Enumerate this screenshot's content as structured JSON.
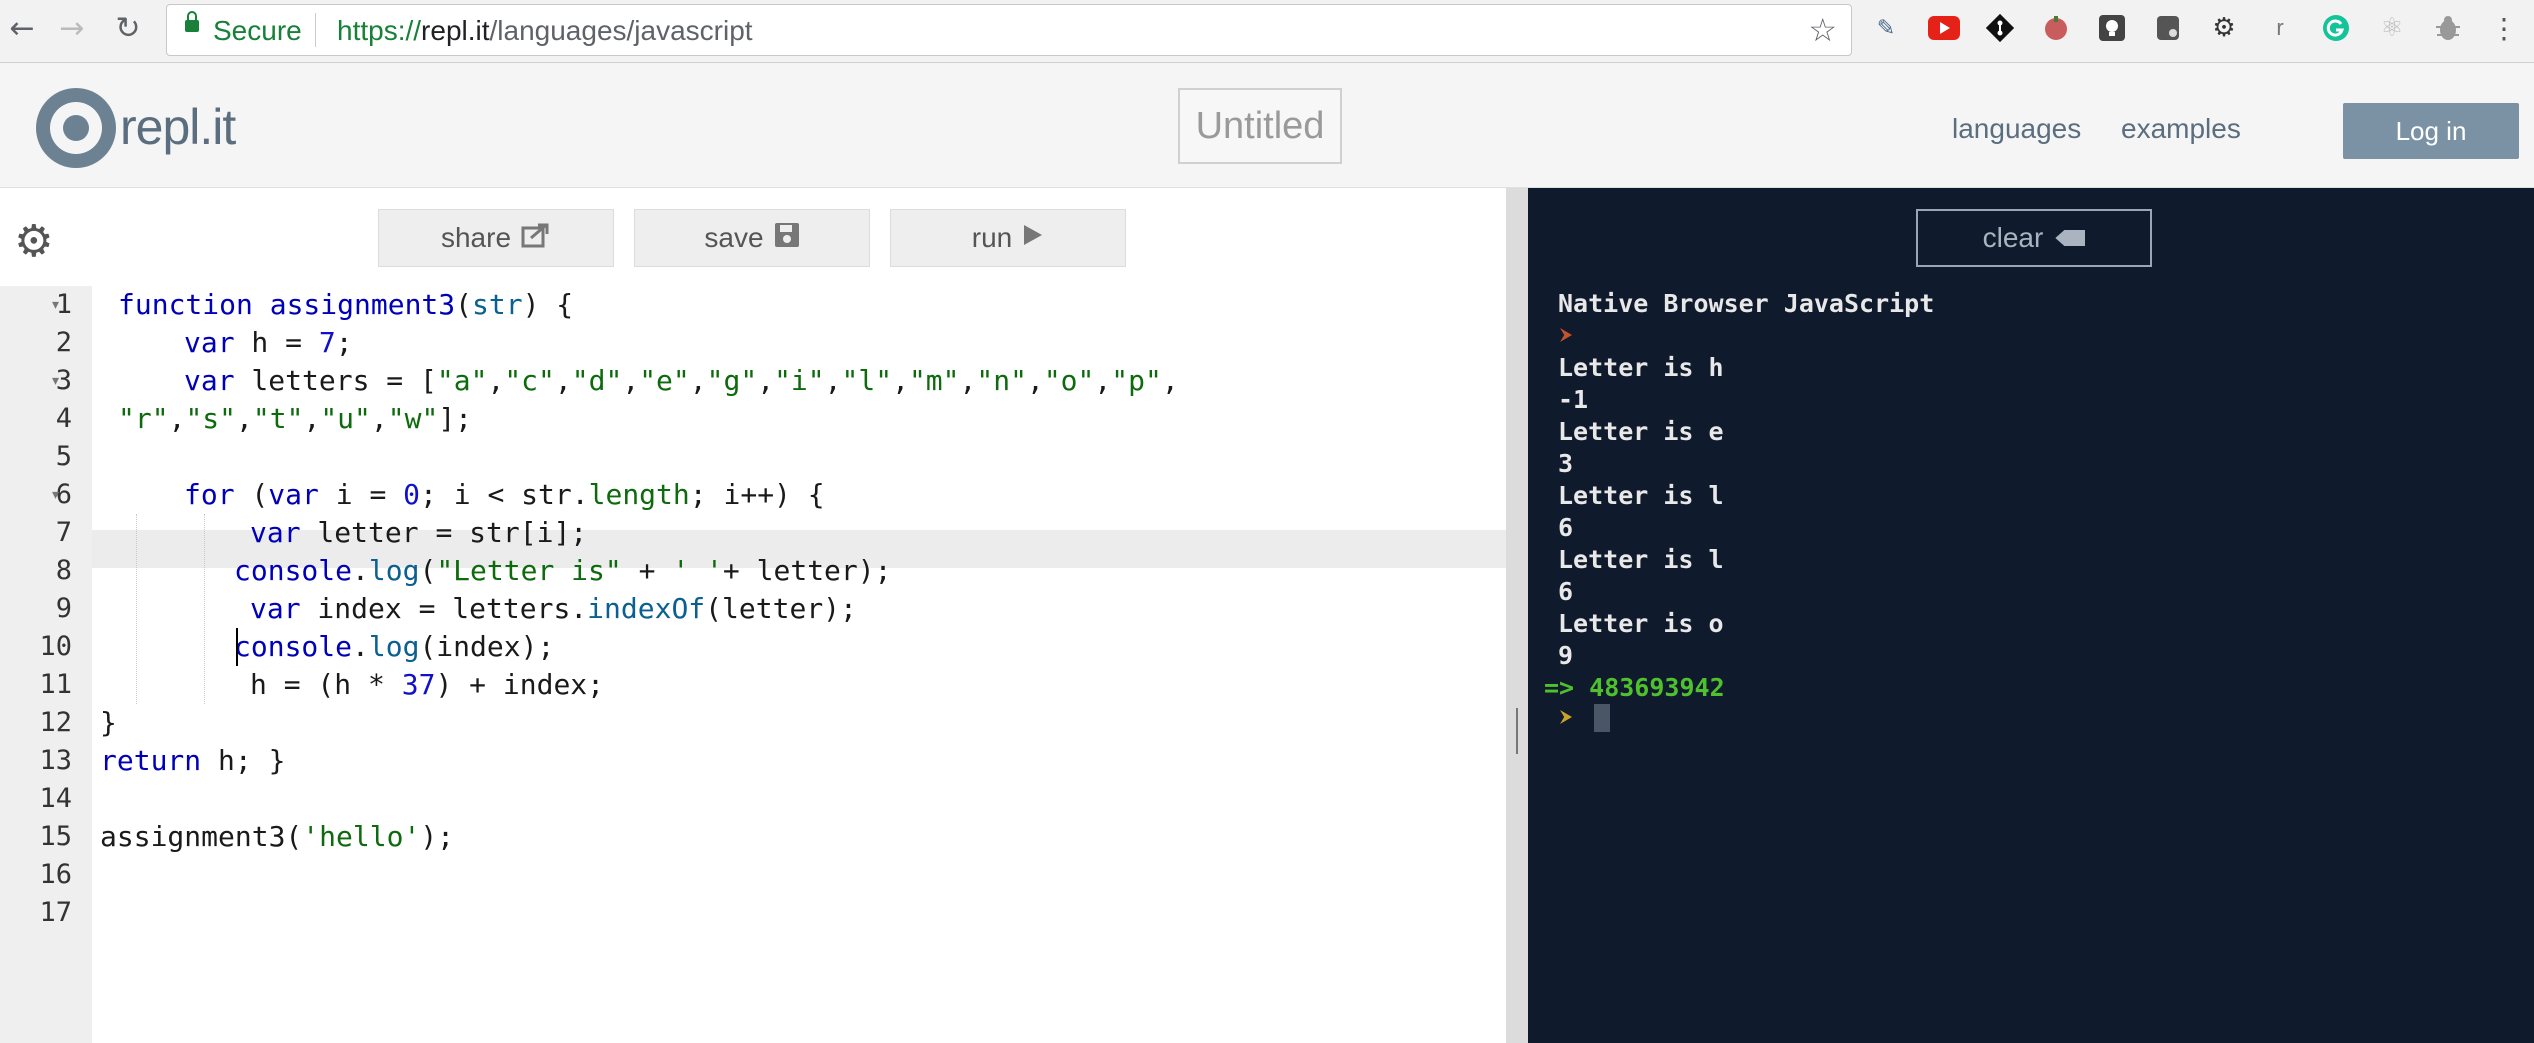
{
  "browser": {
    "secure_label": "Secure",
    "url_proto": "https://",
    "url_host": "repl.it",
    "url_path": "/languages/javascript",
    "extensions": [
      "eyedropper-icon",
      "youtube-icon",
      "git-icon",
      "tomato-icon",
      "lightbulb-icon",
      "evernote-icon",
      "gear-icon",
      "r-icon",
      "grammarly-icon",
      "react-icon",
      "bug-icon",
      "more-icon"
    ]
  },
  "header": {
    "logo_text": "repl.it",
    "title": "Untitled",
    "nav": [
      "languages",
      "examples"
    ],
    "login": "Log in"
  },
  "toolbar": {
    "share": "share",
    "save": "save",
    "run": "run"
  },
  "editor": {
    "line_numbers": [
      "1",
      "2",
      "3",
      "4",
      "5",
      "6",
      "7",
      "8",
      "9",
      "10",
      "11",
      "12",
      "13",
      "14",
      "15",
      "16",
      "17"
    ],
    "active_line": 10,
    "lines": [
      "function assignment3(str) {",
      "var h = 7;",
      "var letters = [\"a\",\"c\",\"d\",\"e\",\"g\",\"i\",\"l\",\"m\",\"n\",\"o\",\"p\",",
      "\"r\",\"s\",\"t\",\"u\",\"w\"];",
      "",
      "for (var i = 0; i < str.length; i++) {",
      "var letter = str[i];",
      "console.log(\"Letter is\" + ' '+ letter);",
      "var index = letters.indexOf(letter);",
      "console.log(index);",
      "h = (h * 37) + index;",
      "}",
      "return h; }",
      "",
      "assignment3('hello');",
      "",
      ""
    ]
  },
  "console": {
    "clear": "clear",
    "header": "Native Browser JavaScript",
    "output": [
      "Letter is h",
      "-1",
      "Letter is e",
      "3",
      "Letter is l",
      "6",
      "Letter is l",
      "6",
      "Letter is o",
      "9"
    ],
    "result": "=> 483693942"
  },
  "colors": {
    "console_bg": "#0f1a2c",
    "result_green": "#4fc12c",
    "login_bg": "#7a92a4"
  }
}
